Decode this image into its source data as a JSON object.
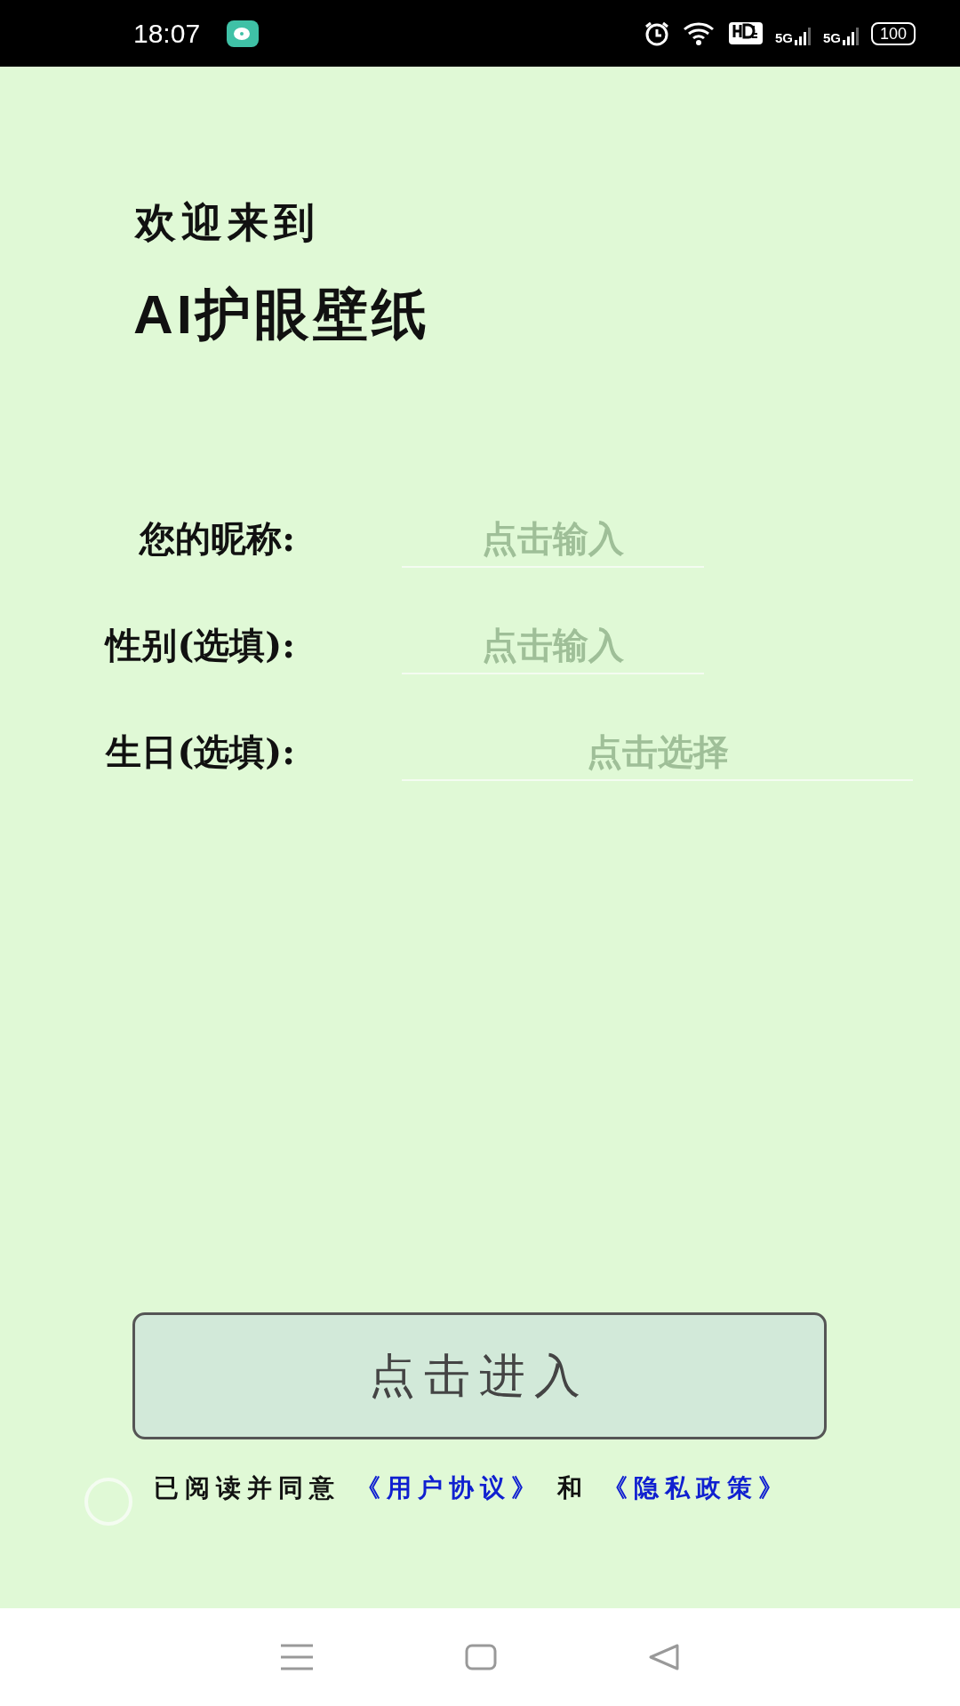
{
  "status_bar": {
    "time": "18:07",
    "battery": "100",
    "network_1": "5G",
    "network_2": "5G"
  },
  "welcome": {
    "line_1": "欢迎来到",
    "line_2": "AI护眼壁纸"
  },
  "form": {
    "fields": [
      {
        "label": "您的昵称:",
        "placeholder": "点击输入",
        "kind": "text"
      },
      {
        "label": "性别(选填):",
        "placeholder": "点击输入",
        "kind": "text"
      },
      {
        "label": "生日(选填):",
        "placeholder": "点击选择",
        "kind": "picker"
      }
    ]
  },
  "enter_button": "点击进入",
  "agreement": {
    "checked": false,
    "text": "已阅读并同意",
    "link_1": "《用户协议》",
    "joiner": "和",
    "link_2": "《隐私政策》"
  }
}
